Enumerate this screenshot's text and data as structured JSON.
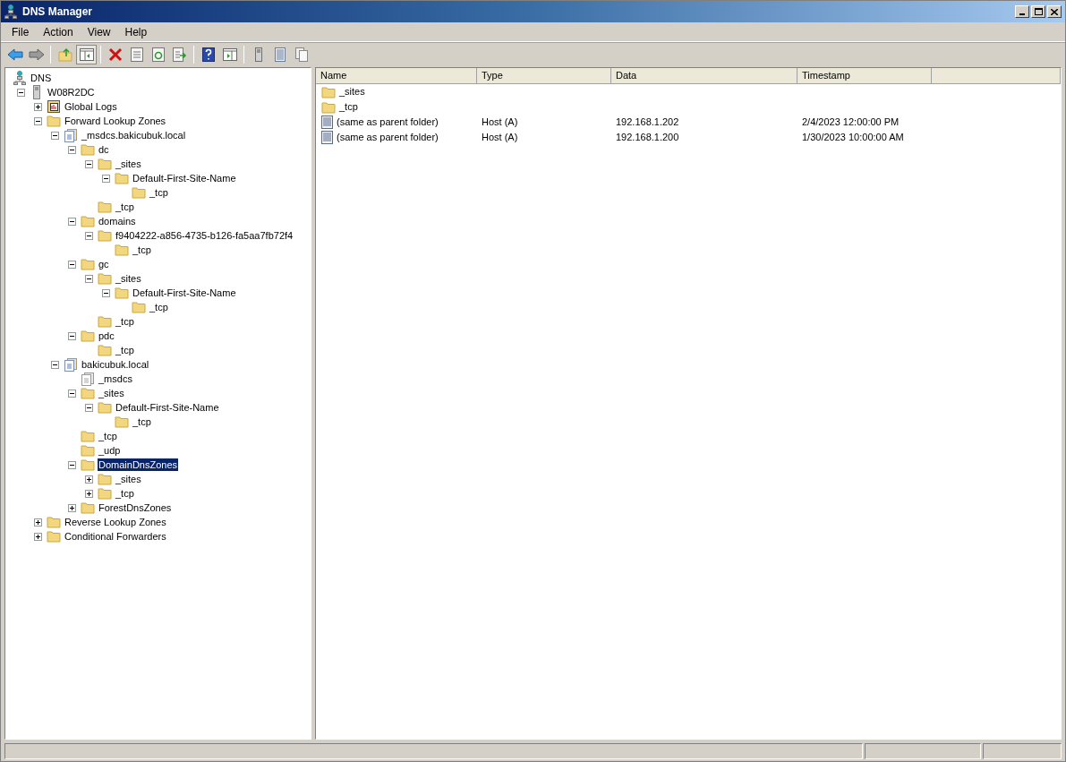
{
  "window": {
    "title": "DNS Manager"
  },
  "menu": [
    "File",
    "Action",
    "View",
    "Help"
  ],
  "tree": [
    {
      "label": "DNS",
      "kind": "dns",
      "selected": false,
      "children": [
        {
          "label": "W08R2DC",
          "kind": "server",
          "expanded": true,
          "selected": false,
          "children": [
            {
              "label": "Global Logs",
              "kind": "logs",
              "expanded": false,
              "selected": false
            },
            {
              "label": "Forward Lookup Zones",
              "kind": "folder",
              "expanded": true,
              "selected": false,
              "children": [
                {
                  "label": "_msdcs.bakicubuk.local",
                  "kind": "zone",
                  "expanded": true,
                  "selected": false,
                  "children": [
                    {
                      "label": "dc",
                      "kind": "folder",
                      "expanded": true,
                      "selected": false,
                      "children": [
                        {
                          "label": "_sites",
                          "kind": "folder",
                          "expanded": true,
                          "selected": false,
                          "children": [
                            {
                              "label": "Default-First-Site-Name",
                              "kind": "folder",
                              "expanded": true,
                              "selected": false,
                              "children": [
                                {
                                  "label": "_tcp",
                                  "kind": "folder",
                                  "selected": false
                                }
                              ]
                            }
                          ]
                        },
                        {
                          "label": "_tcp",
                          "kind": "folder",
                          "selected": false
                        }
                      ]
                    },
                    {
                      "label": "domains",
                      "kind": "folder",
                      "expanded": true,
                      "selected": false,
                      "children": [
                        {
                          "label": "f9404222-a856-4735-b126-fa5aa7fb72f4",
                          "kind": "folder",
                          "expanded": true,
                          "selected": false,
                          "children": [
                            {
                              "label": "_tcp",
                              "kind": "folder",
                              "selected": false
                            }
                          ]
                        }
                      ]
                    },
                    {
                      "label": "gc",
                      "kind": "folder",
                      "expanded": true,
                      "selected": false,
                      "children": [
                        {
                          "label": "_sites",
                          "kind": "folder",
                          "expanded": true,
                          "selected": false,
                          "children": [
                            {
                              "label": "Default-First-Site-Name",
                              "kind": "folder",
                              "expanded": true,
                              "selected": false,
                              "children": [
                                {
                                  "label": "_tcp",
                                  "kind": "folder",
                                  "selected": false
                                }
                              ]
                            }
                          ]
                        },
                        {
                          "label": "_tcp",
                          "kind": "folder",
                          "selected": false
                        }
                      ]
                    },
                    {
                      "label": "pdc",
                      "kind": "folder",
                      "expanded": true,
                      "selected": false,
                      "children": [
                        {
                          "label": "_tcp",
                          "kind": "folder",
                          "selected": false
                        }
                      ]
                    }
                  ]
                },
                {
                  "label": "bakicubuk.local",
                  "kind": "zone",
                  "expanded": true,
                  "selected": false,
                  "children": [
                    {
                      "label": "_msdcs",
                      "kind": "delegation",
                      "selected": false
                    },
                    {
                      "label": "_sites",
                      "kind": "folder",
                      "expanded": true,
                      "selected": false,
                      "children": [
                        {
                          "label": "Default-First-Site-Name",
                          "kind": "folder",
                          "expanded": true,
                          "selected": false,
                          "children": [
                            {
                              "label": "_tcp",
                              "kind": "folder",
                              "selected": false
                            }
                          ]
                        }
                      ]
                    },
                    {
                      "label": "_tcp",
                      "kind": "folder",
                      "selected": false
                    },
                    {
                      "label": "_udp",
                      "kind": "folder",
                      "selected": false
                    },
                    {
                      "label": "DomainDnsZones",
                      "kind": "folder",
                      "expanded": true,
                      "selected": true,
                      "children": [
                        {
                          "label": "_sites",
                          "kind": "folder",
                          "expanded": false,
                          "selected": false
                        },
                        {
                          "label": "_tcp",
                          "kind": "folder",
                          "expanded": false,
                          "selected": false
                        }
                      ]
                    },
                    {
                      "label": "ForestDnsZones",
                      "kind": "folder",
                      "expanded": false,
                      "selected": false
                    }
                  ]
                }
              ]
            },
            {
              "label": "Reverse Lookup Zones",
              "kind": "folder",
              "expanded": false,
              "selected": false
            },
            {
              "label": "Conditional Forwarders",
              "kind": "folder",
              "expanded": false,
              "selected": false
            }
          ]
        }
      ]
    }
  ],
  "list": {
    "columns": [
      "Name",
      "Type",
      "Data",
      "Timestamp"
    ],
    "rows": [
      {
        "kind": "folder",
        "name": "_sites"
      },
      {
        "kind": "folder",
        "name": "_tcp"
      },
      {
        "kind": "record",
        "name": "(same as parent folder)",
        "type": "Host (A)",
        "data": "192.168.1.202",
        "timestamp": "2/4/2023 12:00:00 PM"
      },
      {
        "kind": "record",
        "name": "(same as parent folder)",
        "type": "Host (A)",
        "data": "192.168.1.200",
        "timestamp": "1/30/2023 10:00:00 AM"
      }
    ]
  }
}
